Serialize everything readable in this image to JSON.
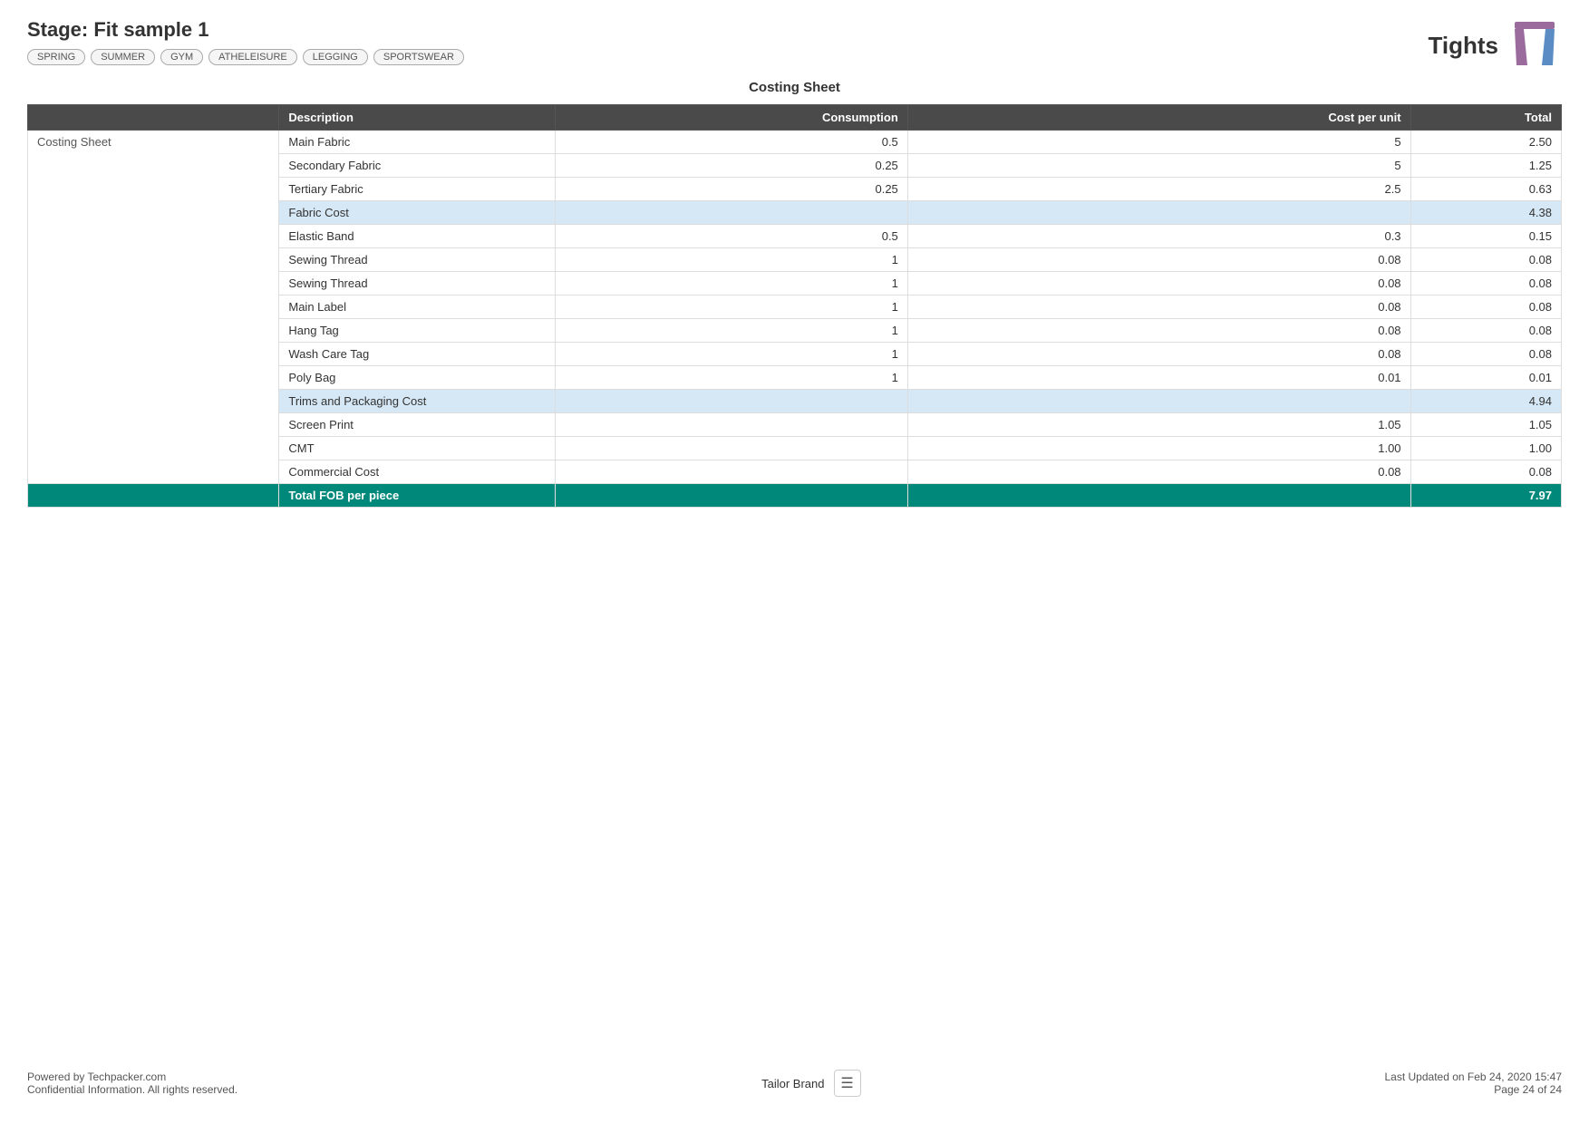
{
  "header": {
    "stage_title": "Stage: Fit sample 1",
    "product_name": "Tights",
    "tags": [
      "SPRING",
      "SUMMER",
      "GYM",
      "ATHELEISURE",
      "LEGGING",
      "SPORTSWEAR"
    ]
  },
  "sheet": {
    "title": "Costing Sheet",
    "section_label": "Costing Sheet",
    "columns": {
      "description": "Description",
      "consumption": "Consumption",
      "cost_per_unit": "Cost per unit",
      "total": "Total"
    },
    "rows": [
      {
        "type": "normal",
        "description": "Main Fabric",
        "consumption": "0.5",
        "cost_per_unit": "5",
        "total": "2.50"
      },
      {
        "type": "normal",
        "description": "Secondary Fabric",
        "consumption": "0.25",
        "cost_per_unit": "5",
        "total": "1.25"
      },
      {
        "type": "normal",
        "description": "Tertiary Fabric",
        "consumption": "0.25",
        "cost_per_unit": "2.5",
        "total": "0.63"
      },
      {
        "type": "subtotal",
        "description": "Fabric Cost",
        "consumption": "",
        "cost_per_unit": "",
        "total": "4.38"
      },
      {
        "type": "normal",
        "description": "Elastic Band",
        "consumption": "0.5",
        "cost_per_unit": "0.3",
        "total": "0.15"
      },
      {
        "type": "normal",
        "description": "Sewing Thread",
        "consumption": "1",
        "cost_per_unit": "0.08",
        "total": "0.08"
      },
      {
        "type": "normal",
        "description": "Sewing Thread",
        "consumption": "1",
        "cost_per_unit": "0.08",
        "total": "0.08"
      },
      {
        "type": "normal",
        "description": "Main Label",
        "consumption": "1",
        "cost_per_unit": "0.08",
        "total": "0.08"
      },
      {
        "type": "normal",
        "description": "Hang Tag",
        "consumption": "1",
        "cost_per_unit": "0.08",
        "total": "0.08"
      },
      {
        "type": "normal",
        "description": "Wash Care Tag",
        "consumption": "1",
        "cost_per_unit": "0.08",
        "total": "0.08"
      },
      {
        "type": "normal",
        "description": "Poly Bag",
        "consumption": "1",
        "cost_per_unit": "0.01",
        "total": "0.01"
      },
      {
        "type": "subtotal",
        "description": "Trims and Packaging Cost",
        "consumption": "",
        "cost_per_unit": "",
        "total": "4.94"
      },
      {
        "type": "normal",
        "description": "Screen Print",
        "consumption": "",
        "cost_per_unit": "1.05",
        "total": "1.05"
      },
      {
        "type": "normal",
        "description": "CMT",
        "consumption": "",
        "cost_per_unit": "1.00",
        "total": "1.00"
      },
      {
        "type": "normal",
        "description": "Commercial Cost",
        "consumption": "",
        "cost_per_unit": "0.08",
        "total": "0.08"
      },
      {
        "type": "total_fob",
        "description": "Total FOB per piece",
        "consumption": "",
        "cost_per_unit": "",
        "total": "7.97"
      }
    ]
  },
  "footer": {
    "powered_by": "Powered by Techpacker.com",
    "confidential": "Confidential Information. All rights reserved.",
    "brand": "Tailor Brand",
    "last_updated": "Last Updated on Feb 24, 2020 15:47",
    "page": "Page 24 of 24"
  }
}
